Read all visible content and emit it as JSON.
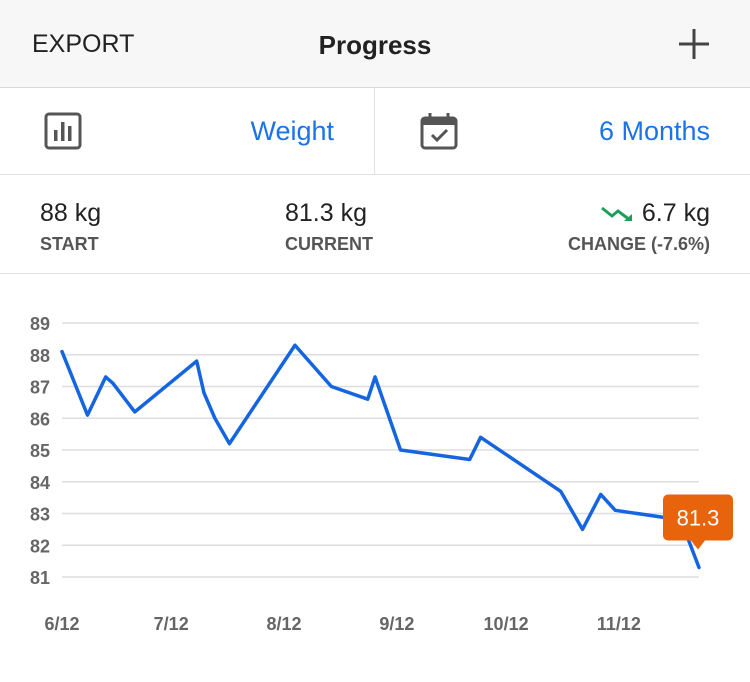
{
  "header": {
    "export_label": "EXPORT",
    "title": "Progress",
    "add_icon": "plus-icon"
  },
  "selectors": {
    "metric": {
      "icon": "bar-chart-icon",
      "label": "Weight"
    },
    "range": {
      "icon": "calendar-check-icon",
      "label": "6 Months"
    }
  },
  "stats": {
    "start": {
      "value": "88 kg",
      "label": "START"
    },
    "current": {
      "value": "81.3 kg",
      "label": "CURRENT"
    },
    "change": {
      "icon": "trending-down-icon",
      "value": "6.7 kg",
      "label": "CHANGE (-7.6%)"
    }
  },
  "colors": {
    "accent": "#1a73e8",
    "line": "#1565e0",
    "marker": "#e8640c",
    "trend_down": "#1e9e5a",
    "grid": "#dddddd"
  },
  "chart_data": {
    "type": "line",
    "title": "",
    "xlabel": "",
    "ylabel": "",
    "ylim": [
      81,
      89
    ],
    "yticks": [
      81,
      82,
      83,
      84,
      85,
      86,
      87,
      88,
      89
    ],
    "x_ticks": [
      "6/12",
      "7/12",
      "8/12",
      "9/12",
      "10/12",
      "11/12"
    ],
    "x_tick_days": [
      0,
      30,
      61,
      92,
      122,
      153
    ],
    "grid": true,
    "series": [
      {
        "days": [
          0,
          7,
          12,
          14,
          20,
          37,
          39,
          42,
          46,
          64,
          74,
          84,
          86,
          93,
          112,
          115,
          137,
          143,
          148,
          152,
          170,
          175
        ],
        "values": [
          88.1,
          86.1,
          87.3,
          87.1,
          86.2,
          87.8,
          86.8,
          86.0,
          85.2,
          88.3,
          87.0,
          86.6,
          87.3,
          85.0,
          84.7,
          85.4,
          83.7,
          82.5,
          83.6,
          83.1,
          82.8,
          81.3
        ]
      }
    ],
    "marker_label": "81.3"
  }
}
